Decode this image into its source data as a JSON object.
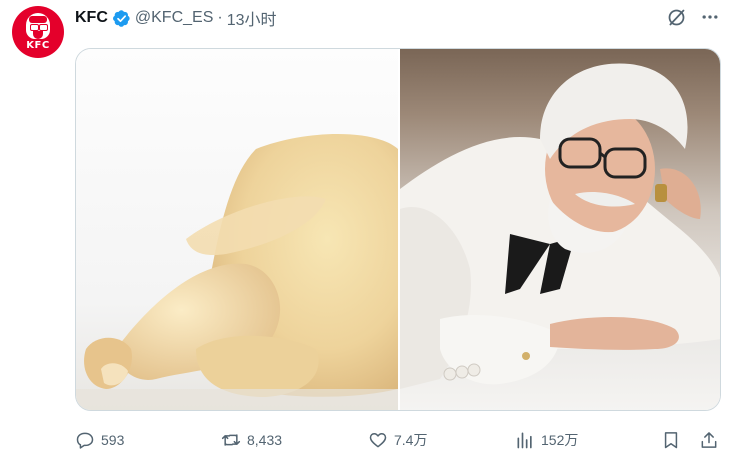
{
  "tweet": {
    "author": {
      "display_name": "KFC",
      "handle": "@KFC_ES",
      "verified": true,
      "avatar_logo_text": "KFC",
      "avatar_color": "#e4002b"
    },
    "separator": "·",
    "timestamp": "13小时",
    "media": [
      {
        "name": "raw-chicken-photo",
        "side": "left"
      },
      {
        "name": "colonel-sanders-photo",
        "side": "right"
      }
    ],
    "stats": {
      "replies": "593",
      "retweets": "8,433",
      "likes": "7.4万",
      "views": "152万"
    }
  },
  "icons": {
    "header_right": [
      "grok-icon",
      "more-icon"
    ],
    "actions": [
      "reply-icon",
      "retweet-icon",
      "like-icon",
      "views-icon",
      "bookmark-icon",
      "share-icon"
    ]
  },
  "colors": {
    "verified": "#1d9bf0",
    "secondary_text": "#536471",
    "primary_text": "#0f1419"
  }
}
